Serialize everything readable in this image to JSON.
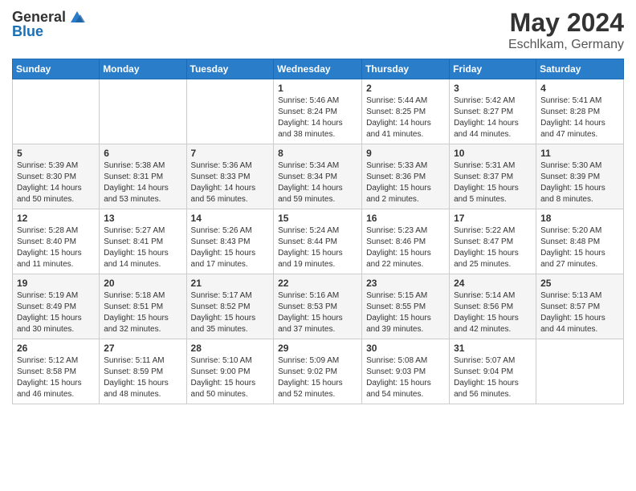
{
  "header": {
    "logo_general": "General",
    "logo_blue": "Blue",
    "month": "May 2024",
    "location": "Eschlkam, Germany"
  },
  "weekdays": [
    "Sunday",
    "Monday",
    "Tuesday",
    "Wednesday",
    "Thursday",
    "Friday",
    "Saturday"
  ],
  "weeks": [
    [
      {
        "day": "",
        "info": ""
      },
      {
        "day": "",
        "info": ""
      },
      {
        "day": "",
        "info": ""
      },
      {
        "day": "1",
        "info": "Sunrise: 5:46 AM\nSunset: 8:24 PM\nDaylight: 14 hours\nand 38 minutes."
      },
      {
        "day": "2",
        "info": "Sunrise: 5:44 AM\nSunset: 8:25 PM\nDaylight: 14 hours\nand 41 minutes."
      },
      {
        "day": "3",
        "info": "Sunrise: 5:42 AM\nSunset: 8:27 PM\nDaylight: 14 hours\nand 44 minutes."
      },
      {
        "day": "4",
        "info": "Sunrise: 5:41 AM\nSunset: 8:28 PM\nDaylight: 14 hours\nand 47 minutes."
      }
    ],
    [
      {
        "day": "5",
        "info": "Sunrise: 5:39 AM\nSunset: 8:30 PM\nDaylight: 14 hours\nand 50 minutes."
      },
      {
        "day": "6",
        "info": "Sunrise: 5:38 AM\nSunset: 8:31 PM\nDaylight: 14 hours\nand 53 minutes."
      },
      {
        "day": "7",
        "info": "Sunrise: 5:36 AM\nSunset: 8:33 PM\nDaylight: 14 hours\nand 56 minutes."
      },
      {
        "day": "8",
        "info": "Sunrise: 5:34 AM\nSunset: 8:34 PM\nDaylight: 14 hours\nand 59 minutes."
      },
      {
        "day": "9",
        "info": "Sunrise: 5:33 AM\nSunset: 8:36 PM\nDaylight: 15 hours\nand 2 minutes."
      },
      {
        "day": "10",
        "info": "Sunrise: 5:31 AM\nSunset: 8:37 PM\nDaylight: 15 hours\nand 5 minutes."
      },
      {
        "day": "11",
        "info": "Sunrise: 5:30 AM\nSunset: 8:39 PM\nDaylight: 15 hours\nand 8 minutes."
      }
    ],
    [
      {
        "day": "12",
        "info": "Sunrise: 5:28 AM\nSunset: 8:40 PM\nDaylight: 15 hours\nand 11 minutes."
      },
      {
        "day": "13",
        "info": "Sunrise: 5:27 AM\nSunset: 8:41 PM\nDaylight: 15 hours\nand 14 minutes."
      },
      {
        "day": "14",
        "info": "Sunrise: 5:26 AM\nSunset: 8:43 PM\nDaylight: 15 hours\nand 17 minutes."
      },
      {
        "day": "15",
        "info": "Sunrise: 5:24 AM\nSunset: 8:44 PM\nDaylight: 15 hours\nand 19 minutes."
      },
      {
        "day": "16",
        "info": "Sunrise: 5:23 AM\nSunset: 8:46 PM\nDaylight: 15 hours\nand 22 minutes."
      },
      {
        "day": "17",
        "info": "Sunrise: 5:22 AM\nSunset: 8:47 PM\nDaylight: 15 hours\nand 25 minutes."
      },
      {
        "day": "18",
        "info": "Sunrise: 5:20 AM\nSunset: 8:48 PM\nDaylight: 15 hours\nand 27 minutes."
      }
    ],
    [
      {
        "day": "19",
        "info": "Sunrise: 5:19 AM\nSunset: 8:49 PM\nDaylight: 15 hours\nand 30 minutes."
      },
      {
        "day": "20",
        "info": "Sunrise: 5:18 AM\nSunset: 8:51 PM\nDaylight: 15 hours\nand 32 minutes."
      },
      {
        "day": "21",
        "info": "Sunrise: 5:17 AM\nSunset: 8:52 PM\nDaylight: 15 hours\nand 35 minutes."
      },
      {
        "day": "22",
        "info": "Sunrise: 5:16 AM\nSunset: 8:53 PM\nDaylight: 15 hours\nand 37 minutes."
      },
      {
        "day": "23",
        "info": "Sunrise: 5:15 AM\nSunset: 8:55 PM\nDaylight: 15 hours\nand 39 minutes."
      },
      {
        "day": "24",
        "info": "Sunrise: 5:14 AM\nSunset: 8:56 PM\nDaylight: 15 hours\nand 42 minutes."
      },
      {
        "day": "25",
        "info": "Sunrise: 5:13 AM\nSunset: 8:57 PM\nDaylight: 15 hours\nand 44 minutes."
      }
    ],
    [
      {
        "day": "26",
        "info": "Sunrise: 5:12 AM\nSunset: 8:58 PM\nDaylight: 15 hours\nand 46 minutes."
      },
      {
        "day": "27",
        "info": "Sunrise: 5:11 AM\nSunset: 8:59 PM\nDaylight: 15 hours\nand 48 minutes."
      },
      {
        "day": "28",
        "info": "Sunrise: 5:10 AM\nSunset: 9:00 PM\nDaylight: 15 hours\nand 50 minutes."
      },
      {
        "day": "29",
        "info": "Sunrise: 5:09 AM\nSunset: 9:02 PM\nDaylight: 15 hours\nand 52 minutes."
      },
      {
        "day": "30",
        "info": "Sunrise: 5:08 AM\nSunset: 9:03 PM\nDaylight: 15 hours\nand 54 minutes."
      },
      {
        "day": "31",
        "info": "Sunrise: 5:07 AM\nSunset: 9:04 PM\nDaylight: 15 hours\nand 56 minutes."
      },
      {
        "day": "",
        "info": ""
      }
    ]
  ]
}
